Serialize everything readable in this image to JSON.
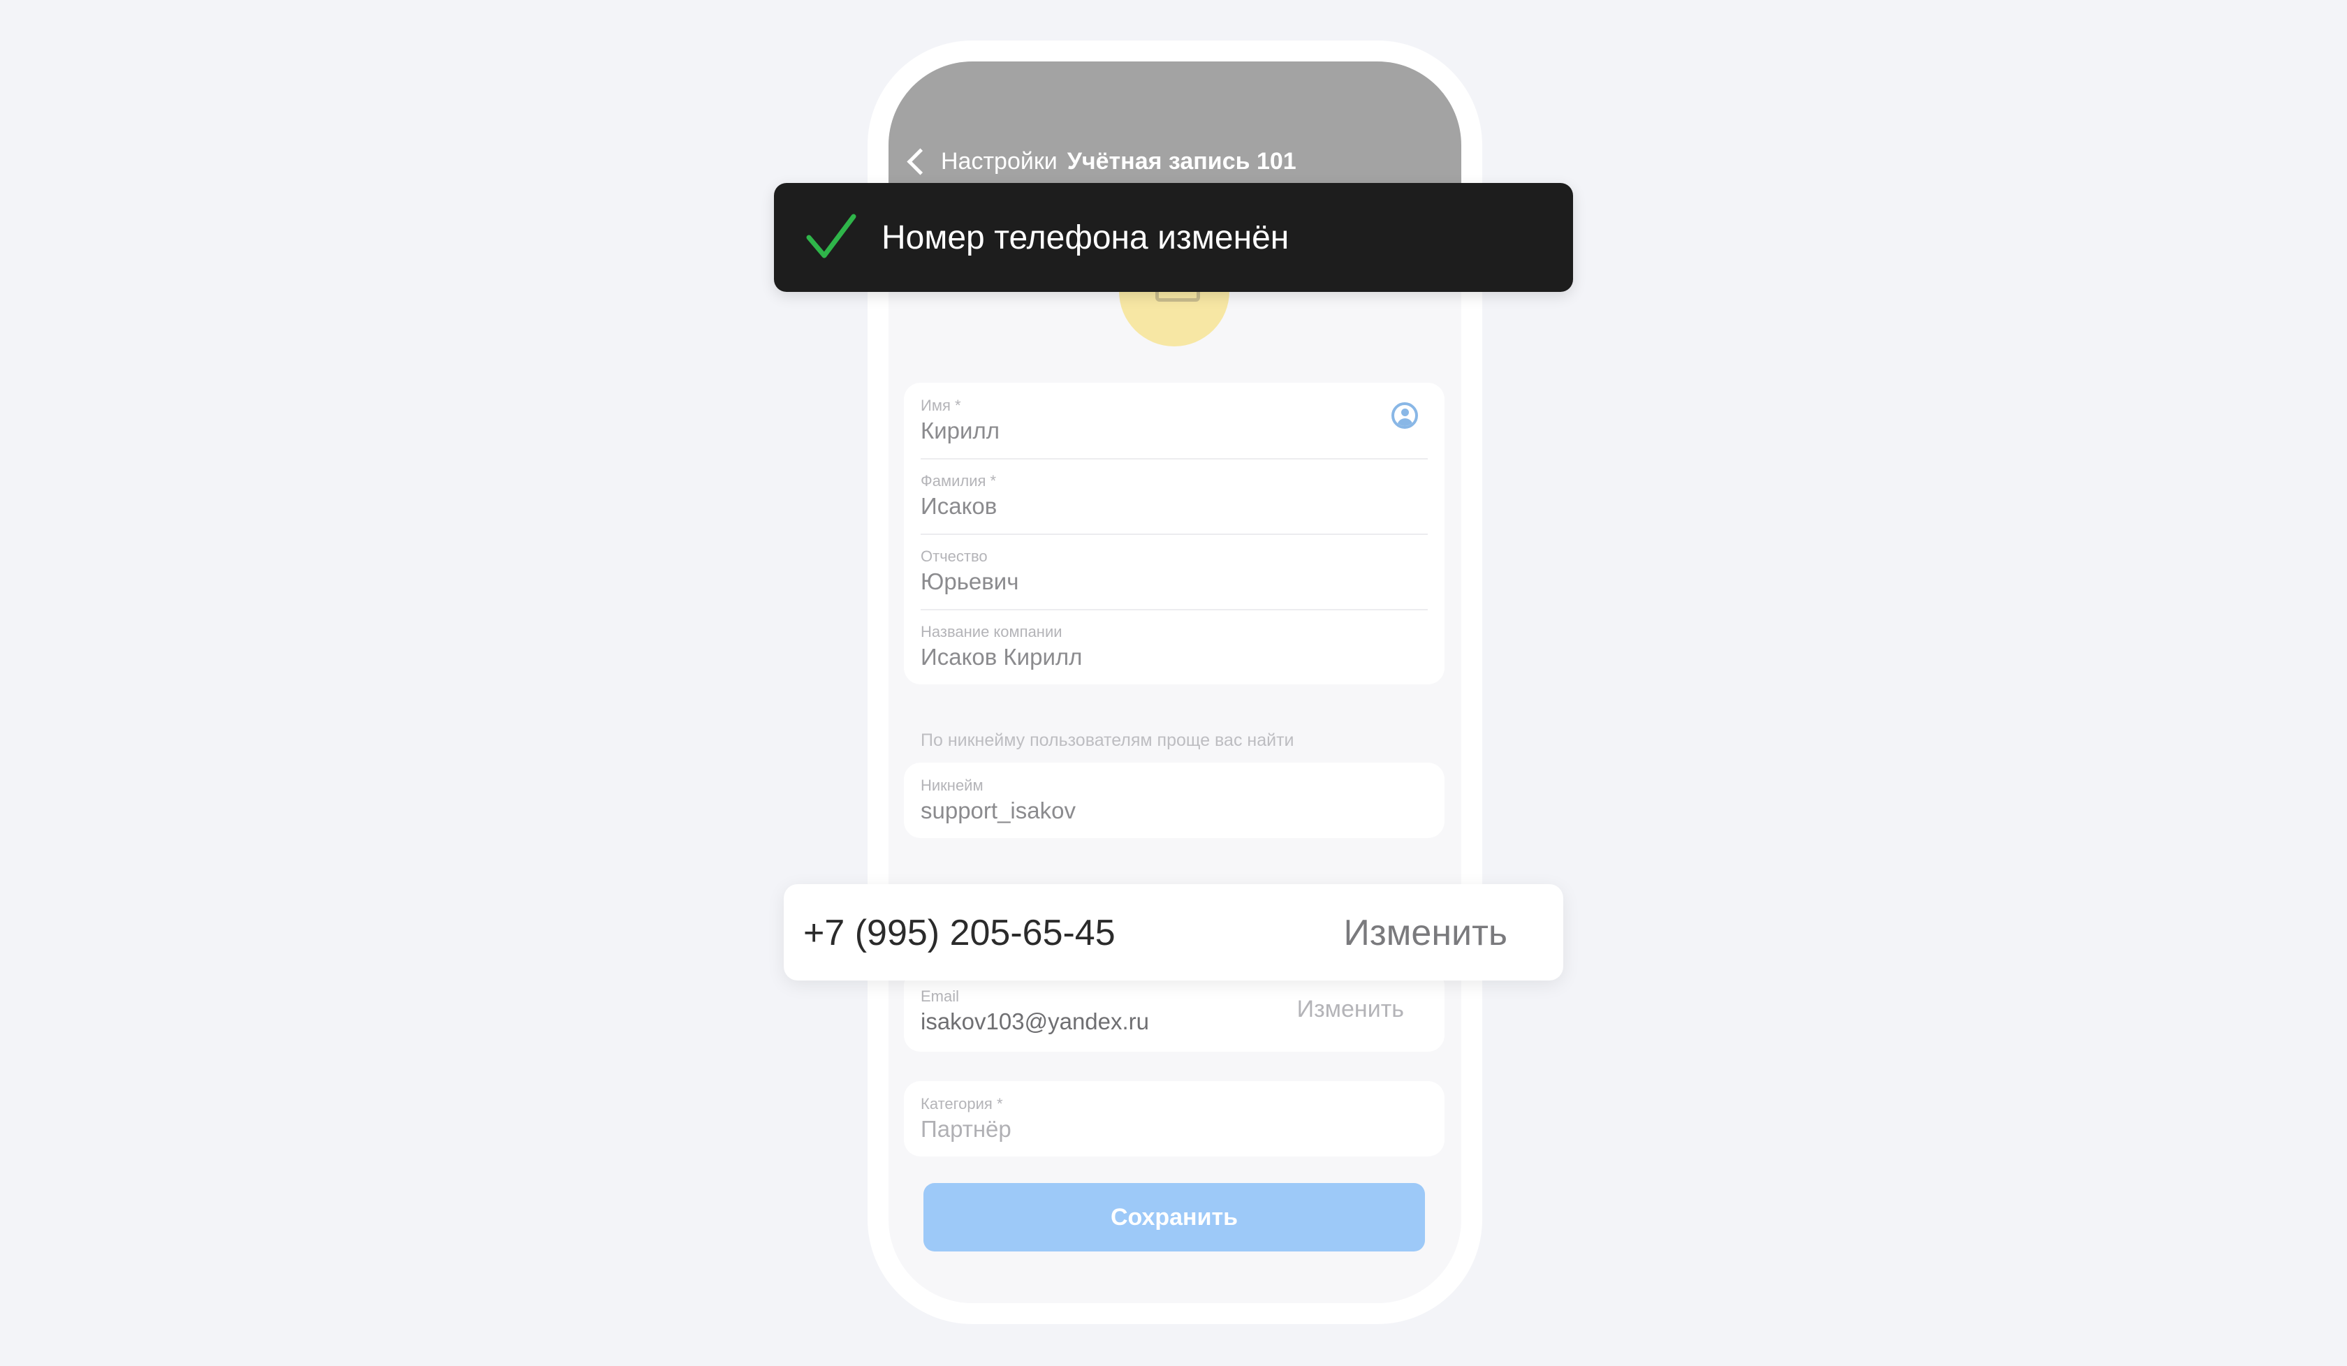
{
  "nav": {
    "back_label": "Настройки",
    "title": "Учётная запись 101"
  },
  "toast": {
    "message": "Номер телефона изменён",
    "icon": "checkmark-icon",
    "icon_color": "#2fb54a"
  },
  "profile_card": {
    "fields": [
      {
        "label": "Имя *",
        "value": "Кирилл"
      },
      {
        "label": "Фамилия *",
        "value": "Исаков"
      },
      {
        "label": "Отчество",
        "value": "Юрьевич"
      },
      {
        "label": "Название компании",
        "value": "Исаков Кирилл"
      }
    ],
    "contact_icon": "contact-picker-icon"
  },
  "nickname": {
    "hint": "По никнейму пользователям проще вас найти",
    "label": "Никнейм",
    "value": "support_isakov"
  },
  "phone": {
    "value": "+7 (995) 205-65-45",
    "action": "Изменить"
  },
  "email": {
    "label": "Email",
    "value": "isakov103@yandex.ru",
    "action": "Изменить"
  },
  "category": {
    "label": "Категория *",
    "value": "Партнёр"
  },
  "save_button": "Сохранить",
  "colors": {
    "accent": "#9dc9f8",
    "toast_bg": "#1d1d1d",
    "header_overlay": "#a3a3a3"
  }
}
